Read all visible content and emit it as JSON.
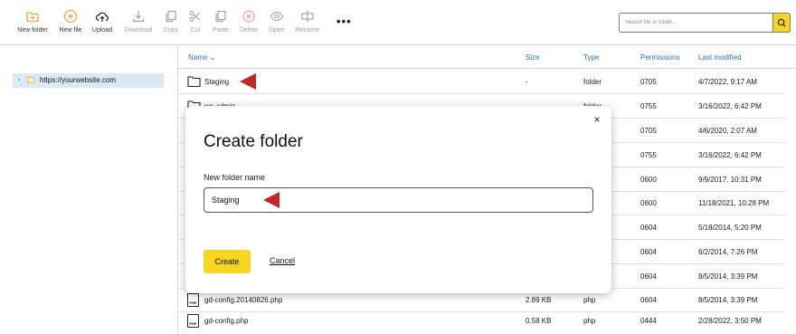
{
  "toolbar": {
    "new_folder": "New folder",
    "new_file": "New file",
    "upload": "Upload",
    "download": "Download",
    "copy": "Copy",
    "cut": "Cut",
    "paste": "Paste",
    "delete": "Delete",
    "open": "Open",
    "rename": "Rename",
    "more": "•••"
  },
  "search": {
    "placeholder": "Search file or folder..."
  },
  "sidebar": {
    "items": [
      {
        "label": "https://yourwebsite.com"
      }
    ]
  },
  "table": {
    "headers": {
      "name": "Name",
      "size": "Size",
      "type": "Type",
      "permissions": "Permissions",
      "modified": "Last modified"
    },
    "rows": [
      {
        "name": "Staging",
        "size": "-",
        "type": "folder",
        "permissions": "0705",
        "modified": "4/7/2022, 9:17 AM"
      },
      {
        "name": "wp-admin",
        "size": "-",
        "type": "folder",
        "permissions": "0755",
        "modified": "3/16/2022, 6:42 PM"
      },
      {
        "name": "",
        "size": "",
        "type": "",
        "permissions": "0705",
        "modified": "4/6/2020, 2:07 AM"
      },
      {
        "name": "",
        "size": "",
        "type": "",
        "permissions": "0755",
        "modified": "3/16/2022, 6:42 PM"
      },
      {
        "name": "",
        "size": "",
        "type": "",
        "permissions": "0600",
        "modified": "9/9/2017, 10:31 PM"
      },
      {
        "name": "",
        "size": "",
        "type": "",
        "permissions": "0600",
        "modified": "11/18/2021, 10:28 PM"
      },
      {
        "name": "",
        "size": "",
        "type": "",
        "permissions": "0604",
        "modified": "5/18/2014, 5:20 PM"
      },
      {
        "name": "",
        "size": "",
        "type": "",
        "permissions": "0604",
        "modified": "6/2/2014, 7:26 PM"
      },
      {
        "name": "",
        "size": "",
        "type": "",
        "permissions": "0604",
        "modified": "8/5/2014, 3:39 PM"
      },
      {
        "name": "gd-config.20140826.php",
        "size": "2.89 KB",
        "type": "php",
        "permissions": "0604",
        "modified": "8/5/2014, 3:39 PM"
      },
      {
        "name": "gd-config.php",
        "size": "0.58 KB",
        "type": "php",
        "permissions": "0444",
        "modified": "2/28/2022, 3:50 PM"
      }
    ]
  },
  "modal": {
    "title": "Create folder",
    "field_label": "New folder name",
    "field_value": "Staging",
    "create_label": "Create",
    "cancel_label": "Cancel",
    "close_label": "×"
  },
  "colors": {
    "accent": "#f8d51e",
    "link": "#2a6fb0",
    "annotation_arrow": "#c22727",
    "selection": "#dbe9f7"
  },
  "icons": [
    "new-folder-icon",
    "new-file-icon",
    "upload-icon",
    "download-icon",
    "copy-icon",
    "cut-icon",
    "paste-icon",
    "delete-icon",
    "open-icon",
    "rename-icon",
    "search-icon",
    "folder-icon",
    "php-file-icon",
    "close-icon"
  ]
}
